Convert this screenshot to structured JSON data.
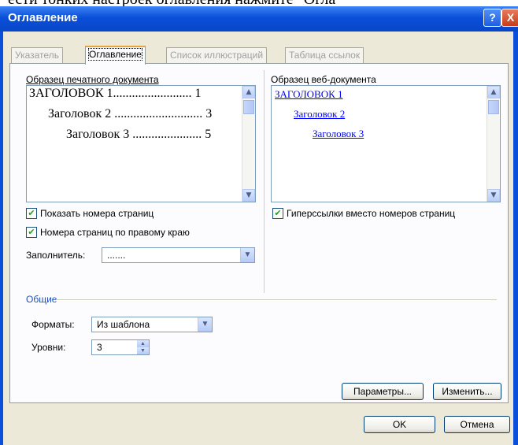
{
  "background_text": "ести тонких настроек оглавления нажмите \"Огла",
  "window": {
    "title": "Оглавление",
    "help_label": "?",
    "close_label": "X"
  },
  "tabs": [
    {
      "label": "Указатель",
      "active": false
    },
    {
      "label": "Оглавление",
      "active": true
    },
    {
      "label": "Список иллюстраций",
      "active": false
    },
    {
      "label": "Таблица ссылок",
      "active": false
    }
  ],
  "print_preview": {
    "label": "Образец печатного документа",
    "lines": [
      {
        "text": "ЗАГОЛОВОК 1......................... 1",
        "level": 1
      },
      {
        "text": "Заголовок 2 ............................ 3",
        "level": 2
      },
      {
        "text": "Заголовок 3 ...................... 5",
        "level": 3
      }
    ]
  },
  "web_preview": {
    "label": "Образец веб-документа",
    "lines": [
      {
        "text": "ЗАГОЛОВОК 1",
        "level": 1
      },
      {
        "text": "Заголовок 2",
        "level": 2
      },
      {
        "text": "Заголовок 3",
        "level": 3
      }
    ]
  },
  "options": {
    "show_page_numbers": {
      "label": "Показать номера страниц",
      "checked": true
    },
    "right_align": {
      "label": "Номера страниц по правому краю",
      "checked": true
    },
    "hyperlinks": {
      "label": "Гиперссылки вместо номеров страниц",
      "checked": true
    },
    "filler_label": "Заполнитель:",
    "filler_value": "......."
  },
  "general": {
    "group_label": "Общие",
    "formats_label": "Форматы:",
    "formats_value": "Из шаблона",
    "levels_label": "Уровни:",
    "levels_value": "3"
  },
  "buttons": {
    "options": "Параметры...",
    "modify": "Изменить...",
    "ok": "OK",
    "cancel": "Отмена"
  },
  "colors": {
    "titlebar": "#0a4fd9",
    "dialog_bg": "#ece9d8",
    "link": "#0000ff",
    "check": "#21a121"
  }
}
